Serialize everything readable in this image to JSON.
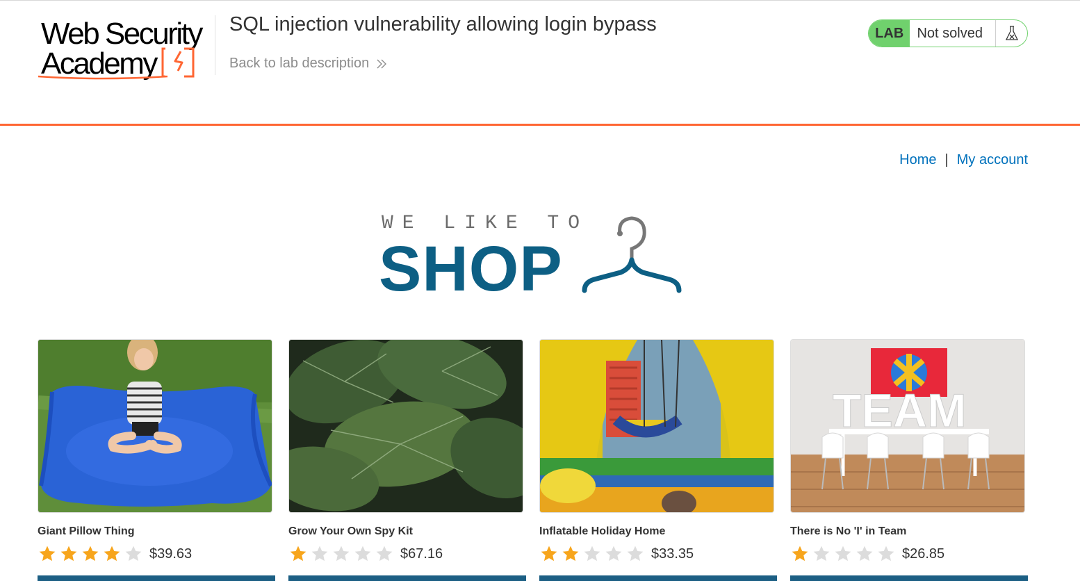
{
  "header": {
    "logo_line1": "Web Security",
    "logo_line2": "Academy",
    "lab_title": "SQL injection vulnerability allowing login bypass",
    "back_link": "Back to lab description",
    "status": {
      "badge": "LAB",
      "text": "Not solved",
      "accent": "#70d16d"
    },
    "rule_color": "#ff6633"
  },
  "nav": {
    "home": "Home",
    "separator": "|",
    "my_account": "My account",
    "link_color": "#0071bc"
  },
  "shop_logo": {
    "tagline": "WE LIKE TO",
    "word": "SHOP",
    "brand_color": "#0d5f84"
  },
  "products": [
    {
      "name": "Giant Pillow Thing",
      "rating": 4,
      "price": "$39.63",
      "image": "blue-bean-bag-photo"
    },
    {
      "name": "Grow Your Own Spy Kit",
      "rating": 1,
      "price": "$67.16",
      "image": "green-leaves-photo"
    },
    {
      "name": "Inflatable Holiday Home",
      "rating": 2,
      "price": "$33.35",
      "image": "bouncy-castle-photo"
    },
    {
      "name": "There is No 'I' in Team",
      "rating": 1,
      "price": "$26.85",
      "image": "team-meeting-room-photo"
    }
  ],
  "rating_max": 5,
  "star_colors": {
    "filled": "#f7a51c",
    "empty": "#dcdcdc"
  }
}
